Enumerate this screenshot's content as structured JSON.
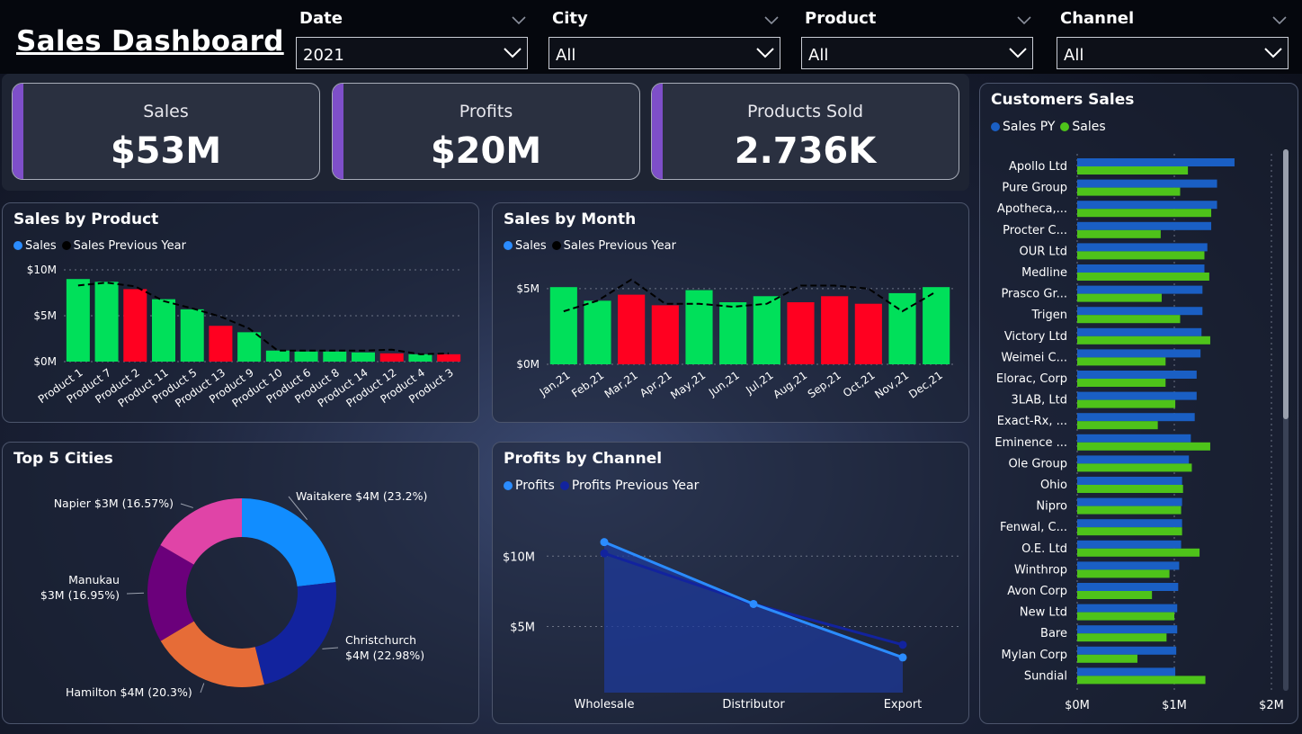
{
  "header": {
    "title": "Sales Dashboard"
  },
  "filters": [
    {
      "label": "Date",
      "value": "2021"
    },
    {
      "label": "City",
      "value": "All"
    },
    {
      "label": "Product",
      "value": "All"
    },
    {
      "label": "Channel",
      "value": "All"
    }
  ],
  "kpis": [
    {
      "label": "Sales",
      "value": "$53M"
    },
    {
      "label": "Profits",
      "value": "$20M"
    },
    {
      "label": "Products Sold",
      "value": "2.736K"
    }
  ],
  "colors": {
    "positive": "#00e05a",
    "negative": "#ff0020",
    "sales_dot": "#2b8cff",
    "prev_dot": "#000000",
    "accent": "#7e4fc9",
    "sales_py": "#1a5fc4",
    "sales_green": "#4ec31a"
  },
  "chart_data": [
    {
      "id": "sales_by_product",
      "type": "bar",
      "title": "Sales by Product",
      "legend": [
        "Sales",
        "Sales Previous Year"
      ],
      "y_ticks": [
        "$10M",
        "$5M",
        "$0M"
      ],
      "ylim": [
        0,
        10
      ],
      "categories": [
        "Product 1",
        "Product 7",
        "Product 2",
        "Product 11",
        "Product 5",
        "Product 13",
        "Product 9",
        "Product 10",
        "Product 6",
        "Product 8",
        "Product 14",
        "Product 12",
        "Product 4",
        "Product 3"
      ],
      "series": [
        {
          "name": "Sales",
          "values": [
            9.0,
            8.7,
            7.9,
            6.8,
            5.7,
            3.9,
            3.2,
            1.2,
            1.1,
            1.1,
            1.0,
            0.9,
            0.8,
            0.8
          ]
        },
        {
          "name": "Sales Previous Year",
          "values": [
            8.3,
            8.6,
            8.2,
            6.6,
            5.8,
            4.9,
            3.6,
            1.2,
            1.2,
            1.2,
            1.2,
            1.3,
            0.8,
            0.9
          ]
        }
      ],
      "bar_status": [
        "up",
        "up",
        "down",
        "up",
        "up",
        "down",
        "up",
        "up",
        "up",
        "up",
        "up",
        "down",
        "up",
        "down"
      ]
    },
    {
      "id": "sales_by_month",
      "type": "bar",
      "title": "Sales by Month",
      "legend": [
        "Sales",
        "Sales Previous Year"
      ],
      "y_ticks": [
        "$5M",
        "$0M"
      ],
      "ylim": [
        0,
        6.3
      ],
      "categories": [
        "Jan,21",
        "Feb,21",
        "Mar,21",
        "Apr,21",
        "May,21",
        "Jun,21",
        "Jul,21",
        "Aug,21",
        "Sep,21",
        "Oct,21",
        "Nov,21",
        "Dec,21"
      ],
      "series": [
        {
          "name": "Sales",
          "values": [
            5.1,
            4.2,
            4.6,
            3.9,
            4.9,
            4.1,
            4.5,
            4.1,
            4.5,
            4.0,
            4.7,
            5.1
          ]
        },
        {
          "name": "Sales Previous Year",
          "values": [
            3.5,
            4.2,
            5.6,
            4.0,
            4.0,
            3.8,
            4.0,
            5.2,
            5.2,
            5.0,
            3.5,
            4.8
          ]
        }
      ],
      "bar_status": [
        "up",
        "up",
        "down",
        "down",
        "up",
        "up",
        "up",
        "down",
        "down",
        "down",
        "up",
        "up"
      ]
    },
    {
      "id": "top_5_cities",
      "type": "pie",
      "title": "Top 5 Cities",
      "slices": [
        {
          "label": "Waitakere $4M (23.2%)",
          "value": 23.2,
          "color": "#118dff"
        },
        {
          "label": "Christchurch\n$4M (22.98%)",
          "value": 22.98,
          "color": "#12239e"
        },
        {
          "label": "Hamilton $4M (20.3%)",
          "value": 20.3,
          "color": "#e66c37"
        },
        {
          "label": "Manukau\n$3M (16.95%)",
          "value": 16.95,
          "color": "#6b007b"
        },
        {
          "label": "Napier $3M (16.57%)",
          "value": 16.57,
          "color": "#e044a7"
        }
      ]
    },
    {
      "id": "profits_by_channel",
      "type": "line",
      "title": "Profits by Channel",
      "legend": [
        "Profits",
        "Profits Previous Year"
      ],
      "y_ticks": [
        "$10M",
        "$5M"
      ],
      "ylim": [
        0.3,
        13.6
      ],
      "categories": [
        "Wholesale",
        "Distributor",
        "Export"
      ],
      "series": [
        {
          "name": "Profits",
          "values": [
            11.0,
            6.6,
            2.8
          ],
          "color": "#2b8cff"
        },
        {
          "name": "Profits Previous Year",
          "values": [
            10.2,
            6.6,
            3.7
          ],
          "color": "#12239e"
        }
      ]
    },
    {
      "id": "customers_sales",
      "type": "bar",
      "orientation": "horizontal",
      "title": "Customers Sales",
      "legend": [
        "Sales PY",
        "Sales"
      ],
      "x_ticks": [
        "$0M",
        "$1M",
        "$2M"
      ],
      "xlim": [
        0,
        2
      ],
      "categories": [
        "Apollo Ltd",
        "Pure Group",
        "Apotheca,...",
        "Procter C...",
        "OUR Ltd",
        "Medline",
        "Prasco Gr...",
        "Trigen",
        "Victory Ltd",
        "Weimei C...",
        "Elorac, Corp",
        "3LAB, Ltd",
        "Exact-Rx, ...",
        "Eminence ...",
        "Ole Group",
        "Ohio",
        "Nipro",
        "Fenwal, C...",
        "O.E. Ltd",
        "Winthrop",
        "Avon Corp",
        "New Ltd",
        "Bare",
        "Mylan Corp",
        "Sundial"
      ],
      "series": [
        {
          "name": "Sales PY",
          "values": [
            1.62,
            1.44,
            1.44,
            1.38,
            1.34,
            1.31,
            1.29,
            1.29,
            1.28,
            1.27,
            1.23,
            1.23,
            1.21,
            1.17,
            1.15,
            1.08,
            1.08,
            1.08,
            1.07,
            1.05,
            1.04,
            1.03,
            1.03,
            1.02,
            1.01
          ]
        },
        {
          "name": "Sales",
          "values": [
            1.14,
            1.06,
            1.38,
            0.86,
            1.31,
            1.36,
            0.87,
            1.06,
            1.37,
            0.91,
            0.91,
            1.01,
            0.83,
            1.37,
            1.18,
            1.09,
            1.07,
            1.08,
            1.26,
            0.95,
            0.77,
            1.0,
            0.92,
            0.62,
            1.32
          ]
        }
      ]
    }
  ]
}
